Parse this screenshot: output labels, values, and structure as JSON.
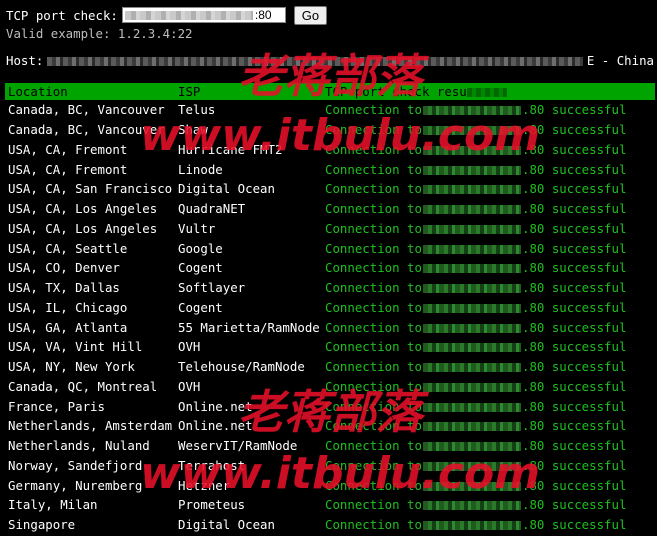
{
  "form": {
    "label": "TCP port check:",
    "input_suffix": ":80",
    "go_label": "Go",
    "example": "Valid example: 1.2.3.4:22"
  },
  "host": {
    "label": "Host:",
    "suffix": "E - China"
  },
  "table": {
    "headers": [
      "Location",
      "ISP",
      "TCP port check resu"
    ],
    "rows": [
      {
        "location": "Canada, BC, Vancouver",
        "isp": "Telus",
        "result": "Connection to",
        "port_result": ".80 successful"
      },
      {
        "location": "Canada, BC, Vancouver",
        "isp": "Shaw",
        "result": "Connection to",
        "port_result": ".80 successful"
      },
      {
        "location": "USA, CA, Fremont",
        "isp": "Hurricane FMT2",
        "result": "Connection to",
        "port_result": ".80 successful"
      },
      {
        "location": "USA, CA, Fremont",
        "isp": "Linode",
        "result": "Connection to",
        "port_result": ".80 successful"
      },
      {
        "location": "USA, CA, San Francisco",
        "isp": "Digital Ocean",
        "result": "Connection to",
        "port_result": ".80 successful"
      },
      {
        "location": "USA, CA, Los Angeles",
        "isp": "QuadraNET",
        "result": "Connection to",
        "port_result": ".80 successful"
      },
      {
        "location": "USA, CA, Los Angeles",
        "isp": "Vultr",
        "result": "Connection to",
        "port_result": ".80 successful"
      },
      {
        "location": "USA, CA, Seattle",
        "isp": "Google",
        "result": "Connection to",
        "port_result": ".80 successful"
      },
      {
        "location": "USA, CO, Denver",
        "isp": "Cogent",
        "result": "Connection to",
        "port_result": ".80 successful"
      },
      {
        "location": "USA, TX, Dallas",
        "isp": "Softlayer",
        "result": "Connection to",
        "port_result": ".80 successful"
      },
      {
        "location": "USA, IL, Chicago",
        "isp": "Cogent",
        "result": "Connection to",
        "port_result": ".80 successful"
      },
      {
        "location": "USA, GA, Atlanta",
        "isp": "55 Marietta/RamNode",
        "result": "Connection to",
        "port_result": ".80 successful"
      },
      {
        "location": "USA, VA, Vint Hill",
        "isp": "OVH",
        "result": "Connection to",
        "port_result": ".80 successful"
      },
      {
        "location": "USA, NY, New York",
        "isp": "Telehouse/RamNode",
        "result": "Connection to",
        "port_result": ".80 successful"
      },
      {
        "location": "Canada, QC, Montreal",
        "isp": "OVH",
        "result": "Connection to",
        "port_result": ".80 successful"
      },
      {
        "location": "France, Paris",
        "isp": "Online.net",
        "result": "Connection to",
        "port_result": ".80 successful"
      },
      {
        "location": "Netherlands, Amsterdam",
        "isp": "Online.net",
        "result": "Connection to",
        "port_result": ".80 successful"
      },
      {
        "location": "Netherlands, Nuland",
        "isp": "WeservIT/RamNode",
        "result": "Connection to",
        "port_result": ".80 successful"
      },
      {
        "location": "Norway, Sandefjord",
        "isp": "Terrahost",
        "result": "Connection to",
        "port_result": ".80 successful"
      },
      {
        "location": "Germany, Nuremberg",
        "isp": "Hetzner",
        "result": "Connection to",
        "port_result": ".80 successful"
      },
      {
        "location": "Italy, Milan",
        "isp": "Prometeus",
        "result": "Connection to",
        "port_result": ".80 successful"
      },
      {
        "location": "Singapore",
        "isp": "Digital Ocean",
        "result": "Connection to",
        "port_result": ".80 successful"
      }
    ]
  },
  "watermark": {
    "cn": "老蒋部落",
    "url": "www.itbulu.com",
    "color": "#e8102a"
  },
  "colors": {
    "header_bg": "#00a400",
    "success_text": "#1fbf1f"
  }
}
